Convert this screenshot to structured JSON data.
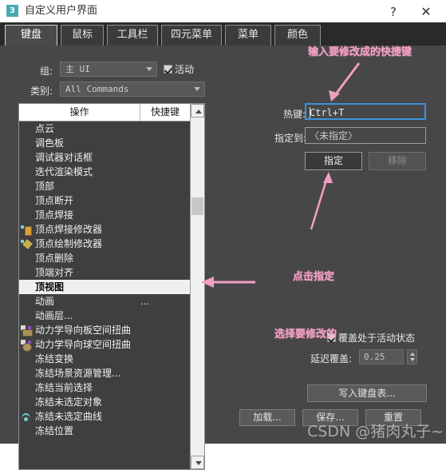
{
  "window": {
    "icon_label": "3",
    "title": "自定义用户界面",
    "help_label": "?",
    "close_label": "✕"
  },
  "tabs": [
    {
      "label": "键盘",
      "active": true
    },
    {
      "label": "鼠标",
      "active": false
    },
    {
      "label": "工具栏",
      "active": false
    },
    {
      "label": "四元菜单",
      "active": false
    },
    {
      "label": "菜单",
      "active": false
    },
    {
      "label": "颜色",
      "active": false
    }
  ],
  "filters": {
    "group_label": "组:",
    "group_value": "主 UI",
    "active_checkbox_label": "活动",
    "active_checked": true,
    "category_label": "类别:",
    "category_value": "All Commands"
  },
  "command_list": {
    "header_action": "操作",
    "header_shortcut": "快捷键",
    "rows": [
      {
        "name": "点云",
        "shortcut": "",
        "icon": "none",
        "selected": false
      },
      {
        "name": "调色板",
        "shortcut": "",
        "icon": "none",
        "selected": false
      },
      {
        "name": "调试器对话框",
        "shortcut": "",
        "icon": "none",
        "selected": false
      },
      {
        "name": "迭代渲染模式",
        "shortcut": "",
        "icon": "none",
        "selected": false
      },
      {
        "name": "顶部",
        "shortcut": "",
        "icon": "none",
        "selected": false
      },
      {
        "name": "顶点断开",
        "shortcut": "",
        "icon": "none",
        "selected": false
      },
      {
        "name": "顶点焊接",
        "shortcut": "",
        "icon": "none",
        "selected": false
      },
      {
        "name": "顶点焊接修改器",
        "shortcut": "",
        "icon": "modifier-yellow",
        "selected": false
      },
      {
        "name": "顶点绘制修改器",
        "shortcut": "",
        "icon": "modifier-brush",
        "selected": false
      },
      {
        "name": "顶点删除",
        "shortcut": "",
        "icon": "none",
        "selected": false
      },
      {
        "name": "顶端对齐",
        "shortcut": "",
        "icon": "none",
        "selected": false
      },
      {
        "name": "顶视图",
        "shortcut": "",
        "icon": "none",
        "selected": true
      },
      {
        "name": "动画",
        "shortcut": "...",
        "icon": "none",
        "selected": false
      },
      {
        "name": "动画层...",
        "shortcut": "",
        "icon": "none",
        "selected": false
      },
      {
        "name": "动力学导向板空间扭曲",
        "shortcut": "",
        "icon": "spacewarp-plane",
        "selected": false
      },
      {
        "name": "动力学导向球空间扭曲",
        "shortcut": "",
        "icon": "spacewarp-sphere",
        "selected": false
      },
      {
        "name": "冻结变换",
        "shortcut": "",
        "icon": "none",
        "selected": false
      },
      {
        "name": "冻结场景资源管理...",
        "shortcut": "",
        "icon": "none",
        "selected": false
      },
      {
        "name": "冻结当前选择",
        "shortcut": "",
        "icon": "none",
        "selected": false
      },
      {
        "name": "冻结未选定对象",
        "shortcut": "",
        "icon": "none",
        "selected": false
      },
      {
        "name": "冻结未选定曲线",
        "shortcut": "",
        "icon": "curve-teal",
        "selected": false
      },
      {
        "name": "冻结位置",
        "shortcut": "",
        "icon": "none",
        "selected": false
      }
    ]
  },
  "hotkey_panel": {
    "hotkey_label": "热键:",
    "hotkey_value": "Ctrl+T",
    "assigned_label": "指定到:",
    "assigned_value": "〈未指定〉",
    "assign_button": "指定",
    "remove_button": "移除"
  },
  "overrides": {
    "override_active_label": "覆盖处于活动状态",
    "override_active_checked": true,
    "delay_label": "延迟覆盖:",
    "delay_value": "0.25"
  },
  "actions": {
    "write_keyboard_chart": "写入键盘表...",
    "load": "加载...",
    "save": "保存...",
    "reset": "重置"
  },
  "annotations": [
    {
      "id": "enter-shortcut",
      "text": "输入要修改成的快捷键"
    },
    {
      "id": "click-assign",
      "text": "点击指定"
    },
    {
      "id": "select-target",
      "text": "选择要修改的"
    }
  ],
  "watermark": {
    "text": "CSDN @猪肉丸子~"
  },
  "colors": {
    "window_bg": "#474747",
    "titlebar_bg": "#ffffff",
    "tabbar_bg": "#2a2a2a",
    "accent_focus": "#3b92e0",
    "annotation_pink": "#f19ec2",
    "icon_teal": "#4aa9b0"
  }
}
